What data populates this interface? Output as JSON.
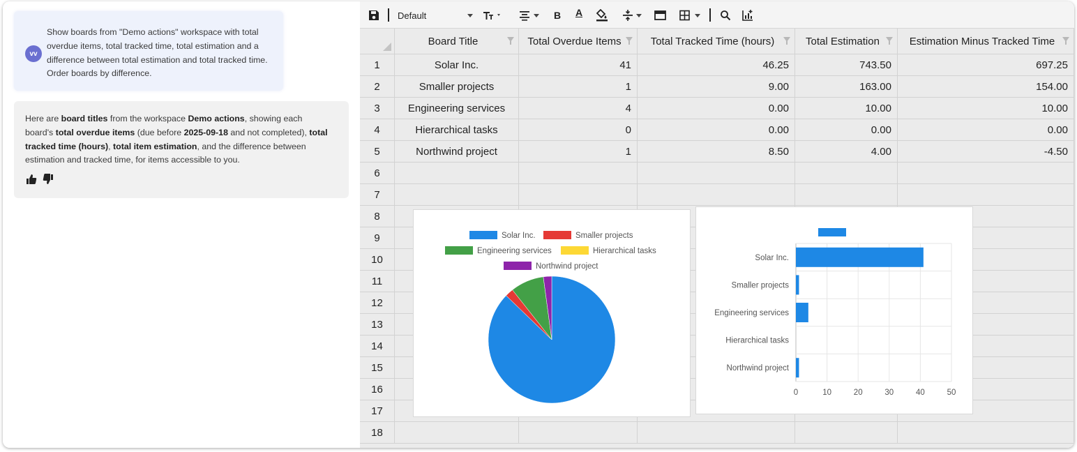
{
  "chat": {
    "user": {
      "avatar": "vv",
      "message": "Show boards from \"Demo actions\" workspace with total overdue items, total tracked time, total estimation and a difference between total estimation and total tracked time. Order boards by difference."
    },
    "assistant": {
      "parts": [
        {
          "t": "Here are ",
          "b": false
        },
        {
          "t": "board titles",
          "b": true
        },
        {
          "t": " from the workspace ",
          "b": false
        },
        {
          "t": "Demo actions",
          "b": true
        },
        {
          "t": ", showing each board's ",
          "b": false
        },
        {
          "t": "total overdue items",
          "b": true
        },
        {
          "t": " (due before ",
          "b": false
        },
        {
          "t": "2025-09-18",
          "b": true
        },
        {
          "t": " and not completed), ",
          "b": false
        },
        {
          "t": "total tracked time (hours)",
          "b": true
        },
        {
          "t": ", ",
          "b": false
        },
        {
          "t": "total item estimation",
          "b": true
        },
        {
          "t": ", and the difference between estimation and tracked time, for items accessible to you.",
          "b": false
        }
      ],
      "icons": [
        "thumbs-up-icon",
        "thumbs-down-icon"
      ]
    }
  },
  "toolbar": {
    "font": "Default",
    "icons": [
      "save-icon",
      "font-size-icon",
      "align-icon",
      "bold-icon",
      "text-color-icon",
      "fill-color-icon",
      "vertical-align-icon",
      "merge-icon",
      "borders-icon",
      "search-icon",
      "insert-chart-icon"
    ],
    "bold_label": "B",
    "text_color_label": "A"
  },
  "table": {
    "columns": [
      "Board Title",
      "Total Overdue Items",
      "Total Tracked Time (hours)",
      "Total Estimation",
      "Estimation Minus Tracked Time"
    ],
    "rows": [
      [
        "Solar Inc.",
        "41",
        "46.25",
        "743.50",
        "697.25"
      ],
      [
        "Smaller projects",
        "1",
        "9.00",
        "163.00",
        "154.00"
      ],
      [
        "Engineering services",
        "4",
        "0.00",
        "10.00",
        "10.00"
      ],
      [
        "Hierarchical tasks",
        "0",
        "0.00",
        "0.00",
        "0.00"
      ],
      [
        "Northwind project",
        "1",
        "8.50",
        "4.00",
        "-4.50"
      ]
    ],
    "row_numbers": [
      "1",
      "2",
      "3",
      "4",
      "5",
      "6",
      "7",
      "8",
      "9",
      "10",
      "11",
      "12",
      "13",
      "14",
      "15",
      "16",
      "17",
      "18"
    ]
  },
  "chart_data": [
    {
      "type": "pie",
      "categories": [
        "Solar Inc.",
        "Smaller projects",
        "Engineering services",
        "Hierarchical tasks",
        "Northwind project"
      ],
      "values": [
        41,
        1,
        4,
        0,
        1
      ],
      "colors": [
        "#1e88e5",
        "#e53935",
        "#43a047",
        "#fdd835",
        "#8e24aa"
      ],
      "legend": "top"
    },
    {
      "type": "bar",
      "orientation": "horizontal",
      "categories": [
        "Solar Inc.",
        "Smaller projects",
        "Engineering services",
        "Hierarchical tasks",
        "Northwind project"
      ],
      "values": [
        41,
        1,
        4,
        0,
        1
      ],
      "color": "#1e88e5",
      "xlim": [
        0,
        50
      ],
      "xticks": [
        "0",
        "10",
        "20",
        "30",
        "40",
        "50"
      ],
      "grid": true,
      "legend": "top"
    }
  ]
}
